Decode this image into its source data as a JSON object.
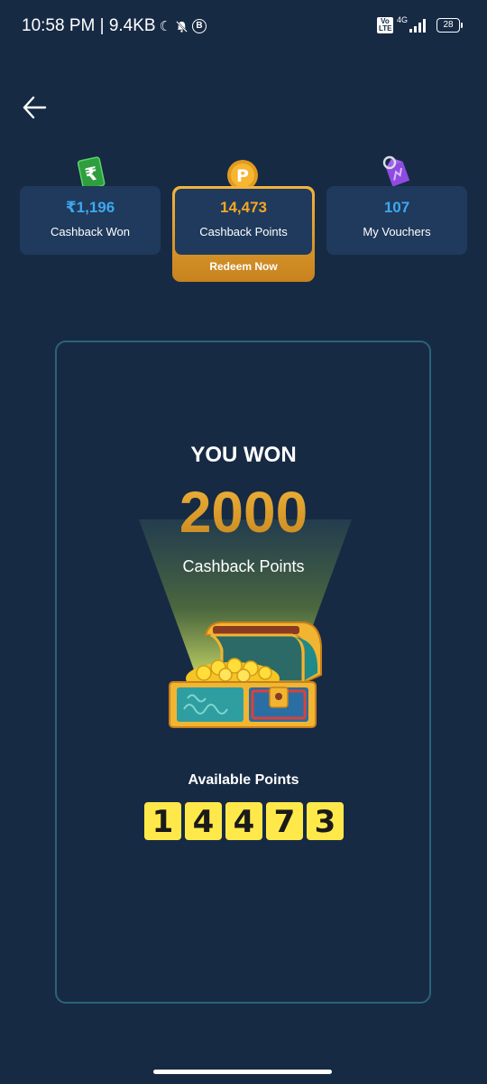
{
  "status_bar": {
    "time_speed": "10:58 PM | 9.4KB",
    "network": "4G",
    "battery": "28"
  },
  "stats": {
    "cashback": {
      "value": "₹1,196",
      "label": "Cashback Won"
    },
    "points": {
      "value": "14,473",
      "label": "Cashback Points",
      "action": "Redeem Now"
    },
    "vouchers": {
      "value": "107",
      "label": "My Vouchers"
    }
  },
  "reward": {
    "heading": "YOU WON",
    "amount": "2000",
    "unit": "Cashback Points",
    "available_label": "Available Points",
    "available_digits": [
      "1",
      "4",
      "4",
      "7",
      "3"
    ]
  },
  "colors": {
    "background": "#172a44",
    "card": "#1f3a5c",
    "accent_blue": "#3fa7f0",
    "accent_gold": "#f5a623",
    "digit_bg": "#ffe94a"
  }
}
